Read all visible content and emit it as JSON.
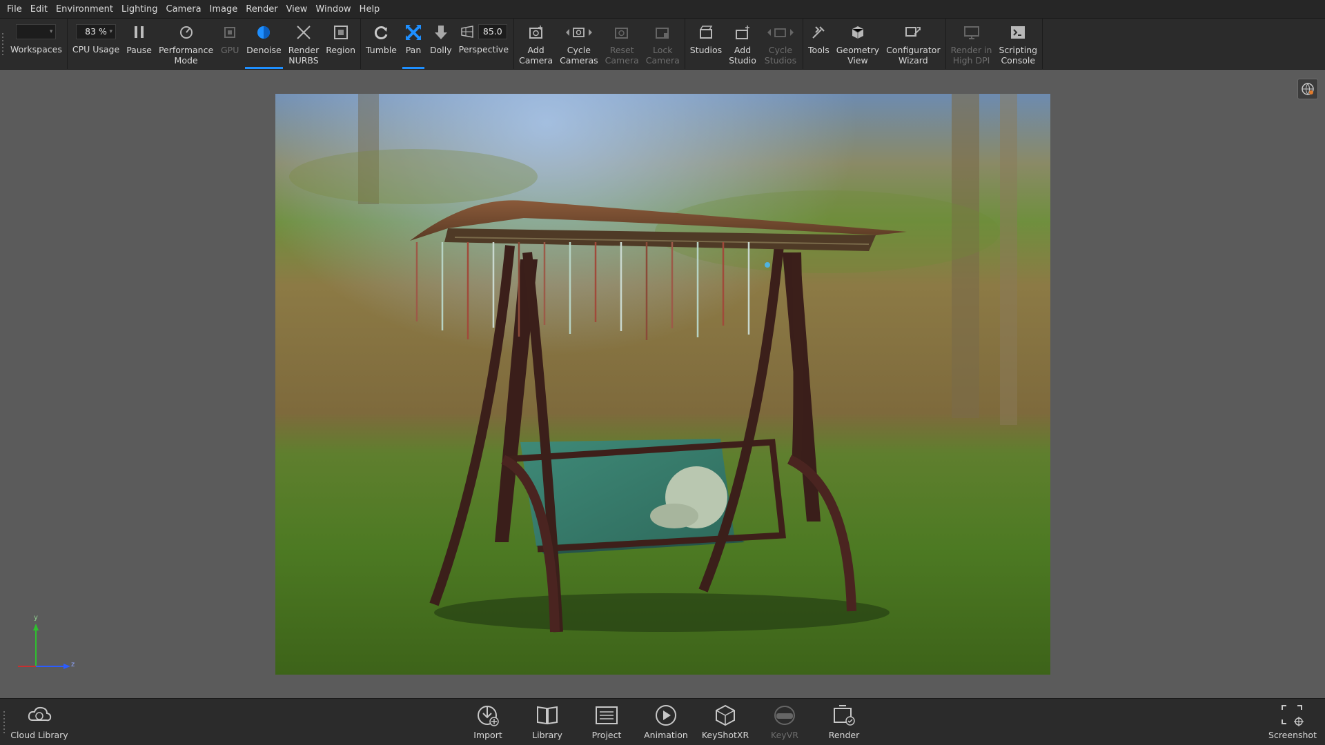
{
  "menu": [
    "File",
    "Edit",
    "Environment",
    "Lighting",
    "Camera",
    "Image",
    "Render",
    "View",
    "Window",
    "Help"
  ],
  "ribbon": {
    "workspaces_label": "Workspaces",
    "cpu_value": "83 %",
    "cpu_label": "CPU Usage",
    "pause_label": "Pause",
    "performance_label": "Performance\nMode",
    "gpu_label": "GPU",
    "denoise_label": "Denoise",
    "render_nurbs_label": "Render\nNURBS",
    "region_label": "Region",
    "tumble_label": "Tumble",
    "pan_label": "Pan",
    "dolly_label": "Dolly",
    "fov_value": "85.0",
    "perspective_label": "Perspective",
    "add_camera_label": "Add\nCamera",
    "cycle_cameras_label": "Cycle\nCameras",
    "reset_camera_label": "Reset\nCamera",
    "lock_camera_label": "Lock\nCamera",
    "studios_label": "Studios",
    "add_studio_label": "Add\nStudio",
    "cycle_studios_label": "Cycle\nStudios",
    "tools_label": "Tools",
    "geometry_view_label": "Geometry\nView",
    "configurator_label": "Configurator\nWizard",
    "high_dpi_label": "Render in\nHigh DPI",
    "scripting_label": "Scripting\nConsole"
  },
  "axis": {
    "y": "y",
    "z": "z"
  },
  "bottom": {
    "cloud_library": "Cloud Library",
    "import": "Import",
    "library": "Library",
    "project": "Project",
    "animation": "Animation",
    "keyshotxr": "KeyShotXR",
    "keyvr": "KeyVR",
    "render": "Render",
    "screenshot": "Screenshot"
  },
  "colors": {
    "accent": "#1e8fff",
    "toolbar_bg": "#2b2b2b",
    "viewport_bg": "#5b5b5b"
  }
}
